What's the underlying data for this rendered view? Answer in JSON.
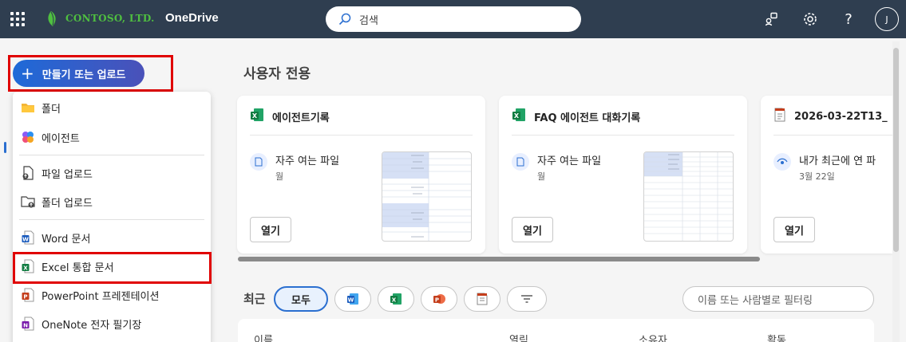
{
  "header": {
    "logo_text": "CONTOSO, LTD.",
    "app_name": "OneDrive",
    "search_placeholder": "검색",
    "avatar_initial": "J"
  },
  "create": {
    "label": "만들기 또는 업로드"
  },
  "menu": {
    "items": [
      {
        "label": "폴더",
        "icon": "folder-icon"
      },
      {
        "label": "에이전트",
        "icon": "agent-icon"
      },
      {
        "label": "파일 업로드",
        "icon": "file-upload-icon"
      },
      {
        "label": "폴더 업로드",
        "icon": "folder-upload-icon"
      },
      {
        "label": "Word 문서",
        "icon": "word-icon"
      },
      {
        "label": "Excel 통합 문서",
        "icon": "excel-icon"
      },
      {
        "label": "PowerPoint 프레젠테이션",
        "icon": "powerpoint-icon"
      },
      {
        "label": "OneNote 전자 필기장",
        "icon": "onenote-icon"
      }
    ]
  },
  "main": {
    "section_title": "사용자 전용",
    "cards": [
      {
        "title": "에이전트기록",
        "file_icon": "excel-icon",
        "reason": "자주 여는 파일",
        "reason_sub": "월",
        "open_label": "열기"
      },
      {
        "title": "FAQ 에이전트 대화기록",
        "file_icon": "excel-icon",
        "reason": "자주 여는 파일",
        "reason_sub": "월",
        "open_label": "열기"
      },
      {
        "title": "2026-03-22T13_",
        "file_icon": "note-file-icon",
        "reason": "내가 최근에 연 파",
        "reason_sub": "3월 22일",
        "open_label": "열기"
      }
    ],
    "recent_label": "최근",
    "filter_all": "모두",
    "filter_placeholder": "이름 또는 사람별로 필터링",
    "columns": [
      "이름",
      "열림",
      "소유자",
      "활동"
    ]
  },
  "colors": {
    "header_bg": "#2f3e50",
    "accent": "#2b6fd0",
    "highlight": "#e00000",
    "excel": "#107c41"
  }
}
